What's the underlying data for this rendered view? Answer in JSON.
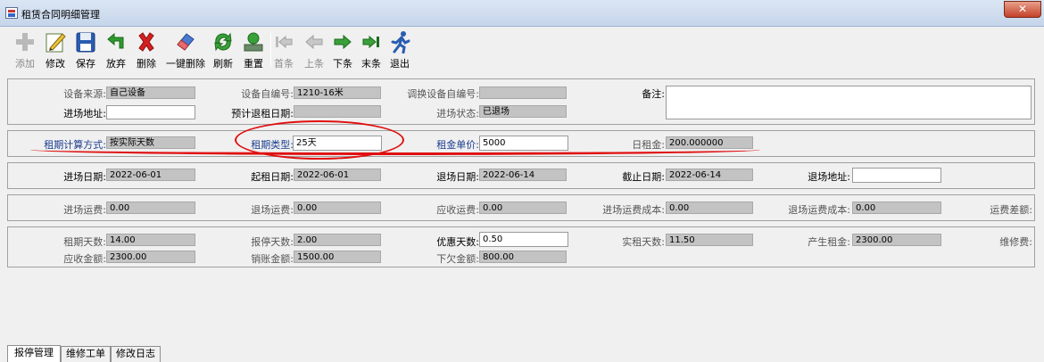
{
  "window": {
    "title": "租赁合同明细管理",
    "close_label": "✕"
  },
  "toolbar": [
    {
      "id": "add",
      "label": "添加",
      "icon": "plus-icon",
      "disabled": true
    },
    {
      "id": "edit",
      "label": "修改",
      "icon": "edit-pencil-icon",
      "disabled": false
    },
    {
      "id": "save",
      "label": "保存",
      "icon": "floppy-disk-icon",
      "disabled": false
    },
    {
      "id": "discard",
      "label": "放弃",
      "icon": "undo-arrow-icon",
      "disabled": false
    },
    {
      "id": "delete",
      "label": "删除",
      "icon": "red-x-icon",
      "disabled": false
    },
    {
      "id": "delete-all",
      "label": "一键删除",
      "icon": "eraser-icon",
      "disabled": false
    },
    {
      "id": "refresh",
      "label": "刷新",
      "icon": "refresh-arrows-icon",
      "disabled": false
    },
    {
      "id": "reset",
      "label": "重置",
      "icon": "reset-tray-icon",
      "disabled": false
    },
    {
      "id": "first",
      "label": "首条",
      "icon": "first-record-icon",
      "disabled": true
    },
    {
      "id": "prev",
      "label": "上条",
      "icon": "prev-arrow-icon",
      "disabled": true
    },
    {
      "id": "next",
      "label": "下条",
      "icon": "next-arrow-icon",
      "disabled": false
    },
    {
      "id": "last",
      "label": "末条",
      "icon": "last-record-icon",
      "disabled": false
    },
    {
      "id": "exit",
      "label": "退出",
      "icon": "running-man-icon",
      "disabled": false
    }
  ],
  "panel1": {
    "source_label": "设备来源:",
    "source_value": "自己设备",
    "devno_label": "设备自编号:",
    "devno_value": "1210-16米",
    "swapno_label": "调换设备自编号:",
    "swapno_value": "",
    "remark_label": "备注:",
    "remark_value": "",
    "address_label": "进场地址:",
    "address_value": "",
    "planned_return_label": "预计退租日期:",
    "planned_return_value": "",
    "entry_status_label": "进场状态:",
    "entry_status_value": "已退场"
  },
  "panel2": {
    "calc_method_label": "租期计算方式:",
    "calc_method_value": "按实际天数",
    "period_type_label": "租期类型:",
    "period_type_value": "25天",
    "unit_price_label": "租金单价:",
    "unit_price_value": "5000",
    "daily_rent_label": "日租金:",
    "daily_rent_value": "200.000000"
  },
  "panel3": {
    "entry_date_label": "进场日期:",
    "entry_date_value": "2022-06-01",
    "start_date_label": "起租日期:",
    "start_date_value": "2022-06-01",
    "exit_date_label": "退场日期:",
    "exit_date_value": "2022-06-14",
    "end_date_label": "截止日期:",
    "end_date_value": "2022-06-14",
    "exit_address_label": "退场地址:",
    "exit_address_value": ""
  },
  "panel4": {
    "entry_freight_label": "进场运费:",
    "entry_freight_value": "0.00",
    "exit_freight_label": "退场运费:",
    "exit_freight_value": "0.00",
    "receivable_freight_label": "应收运费:",
    "receivable_freight_value": "0.00",
    "entry_freight_cost_label": "进场运费成本:",
    "entry_freight_cost_value": "0.00",
    "exit_freight_cost_label": "退场运费成本:",
    "exit_freight_cost_value": "0.00",
    "freight_diff_label": "运费差额:"
  },
  "panel5": {
    "rent_days_label": "租期天数:",
    "rent_days_value": "14.00",
    "stop_days_label": "报停天数:",
    "stop_days_value": "2.00",
    "discount_days_label": "优惠天数:",
    "discount_days_value": "0.50",
    "actual_days_label": "实租天数:",
    "actual_days_value": "11.50",
    "rent_generated_label": "产生租金:",
    "rent_generated_value": "2300.00",
    "repair_fee_label": "维修费:",
    "receivable_label": "应收金额:",
    "receivable_value": "2300.00",
    "written_off_label": "销账金额:",
    "written_off_value": "1500.00",
    "owed_label": "下欠金额:",
    "owed_value": "800.00"
  },
  "tabs": [
    {
      "label": "报停管理",
      "active": true
    },
    {
      "label": "维修工单",
      "active": false
    },
    {
      "label": "修改日志",
      "active": false
    }
  ]
}
